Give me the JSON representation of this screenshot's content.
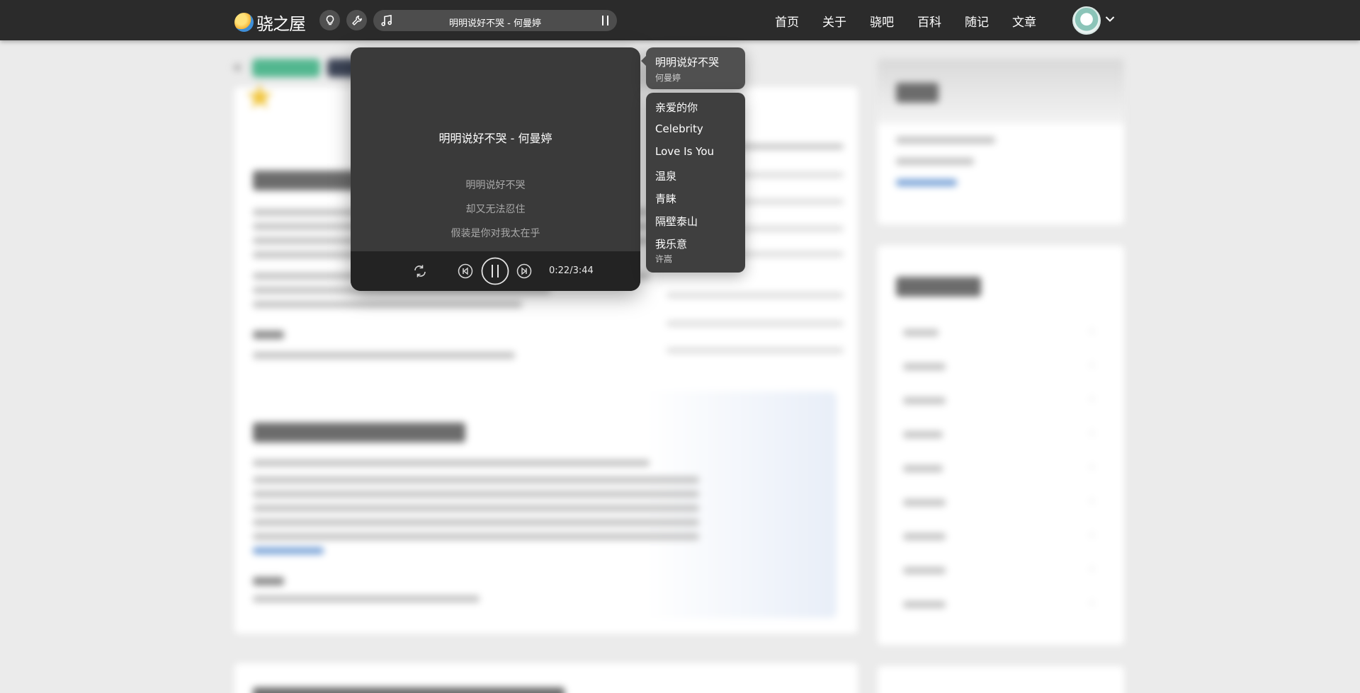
{
  "header": {
    "brand": "骁之屋",
    "icons": [
      "lightbulb-icon",
      "wrench-icon",
      "music-note-icon",
      "pause-icon"
    ],
    "music_bar_title": "明明说好不哭 - 何曼婷",
    "nav": [
      "首页",
      "关于",
      "骁吧",
      "百科",
      "随记",
      "文章"
    ]
  },
  "player": {
    "title": "明明说好不哭 - 何曼婷",
    "lyrics": [
      "明明说好不哭",
      "却又无法忍住",
      "假装是你对我太在乎"
    ],
    "time": "0:22/3:44",
    "icons": [
      "repeat-icon",
      "previous-icon",
      "pause-icon",
      "next-icon"
    ]
  },
  "playlist": {
    "current": {
      "title": "明明说好不哭",
      "artist": "何曼婷"
    },
    "items": [
      {
        "title": "亲爱的你"
      },
      {
        "title": "Celebrity"
      },
      {
        "title": "Love Is You"
      },
      {
        "title": "温泉"
      },
      {
        "title": "青睐"
      },
      {
        "title": "隔壁泰山"
      },
      {
        "title": "我乐意",
        "artist": "许嵩"
      }
    ]
  },
  "colors": {
    "topbar": "#2b2b2b",
    "player_bg": "#3a3a3a",
    "tag_green": "#52b78f",
    "star": "#f0c43a"
  }
}
